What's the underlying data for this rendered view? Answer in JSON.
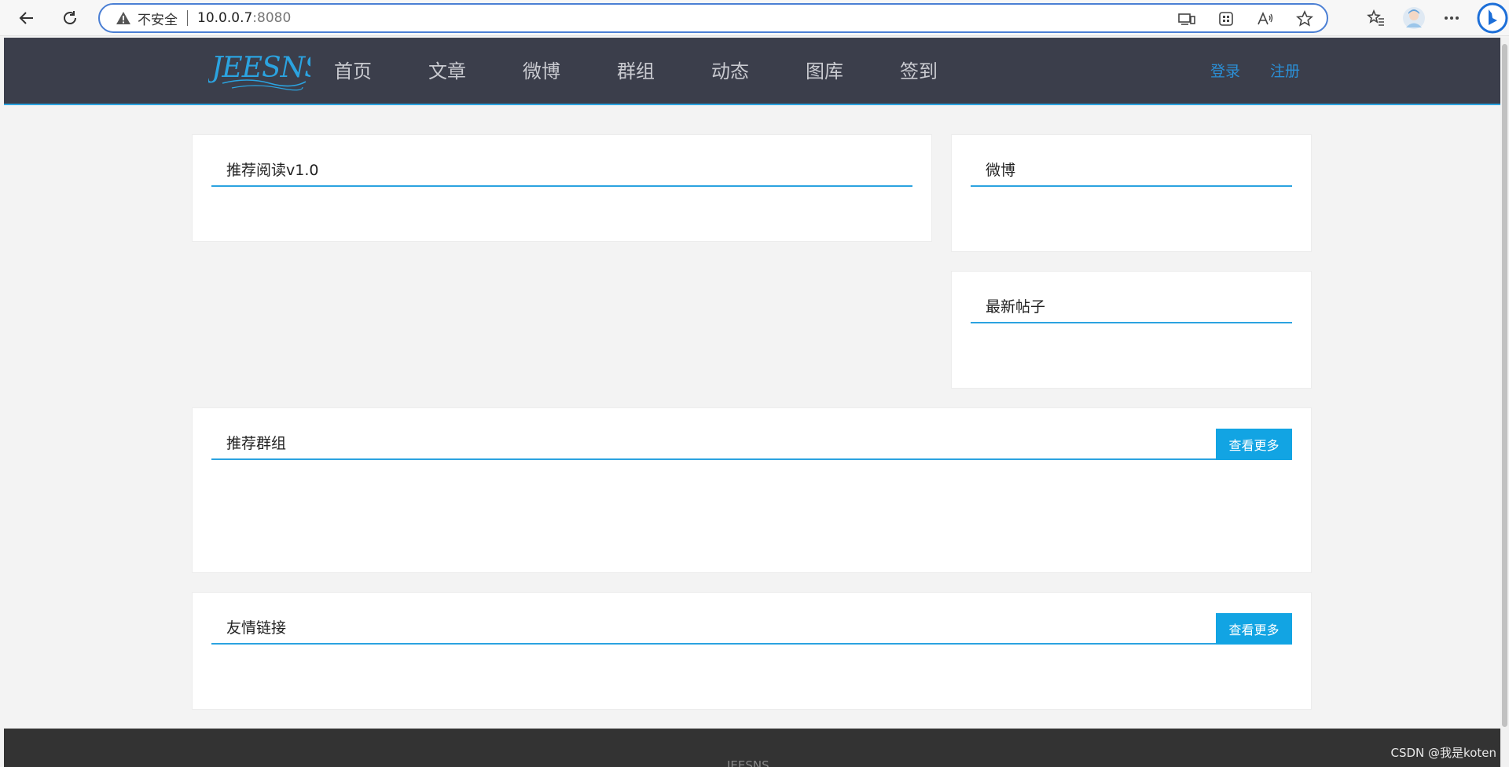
{
  "browser": {
    "security_label": "不安全",
    "url_host": "10.0.0.7",
    "url_port": ":8080"
  },
  "site": {
    "logo_text": "JEESNS",
    "nav": [
      "首页",
      "文章",
      "微博",
      "群组",
      "动态",
      "图库",
      "签到"
    ],
    "login": "登录",
    "register": "注册"
  },
  "panels": {
    "recommended_reading": "推荐阅读v1.0",
    "weibo": "微博",
    "latest_posts": "最新帖子",
    "recommended_groups": "推荐群组",
    "friend_links": "友情链接",
    "more_label": "查看更多"
  },
  "footer": {
    "text": "JEESNS"
  },
  "watermark": "CSDN @我是koten",
  "colors": {
    "header_bg": "#3b3e4b",
    "accent": "#2ba3e0",
    "button_bg": "#12a4e3",
    "link": "#2b8fd6",
    "page_bg": "#f3f3f3"
  }
}
